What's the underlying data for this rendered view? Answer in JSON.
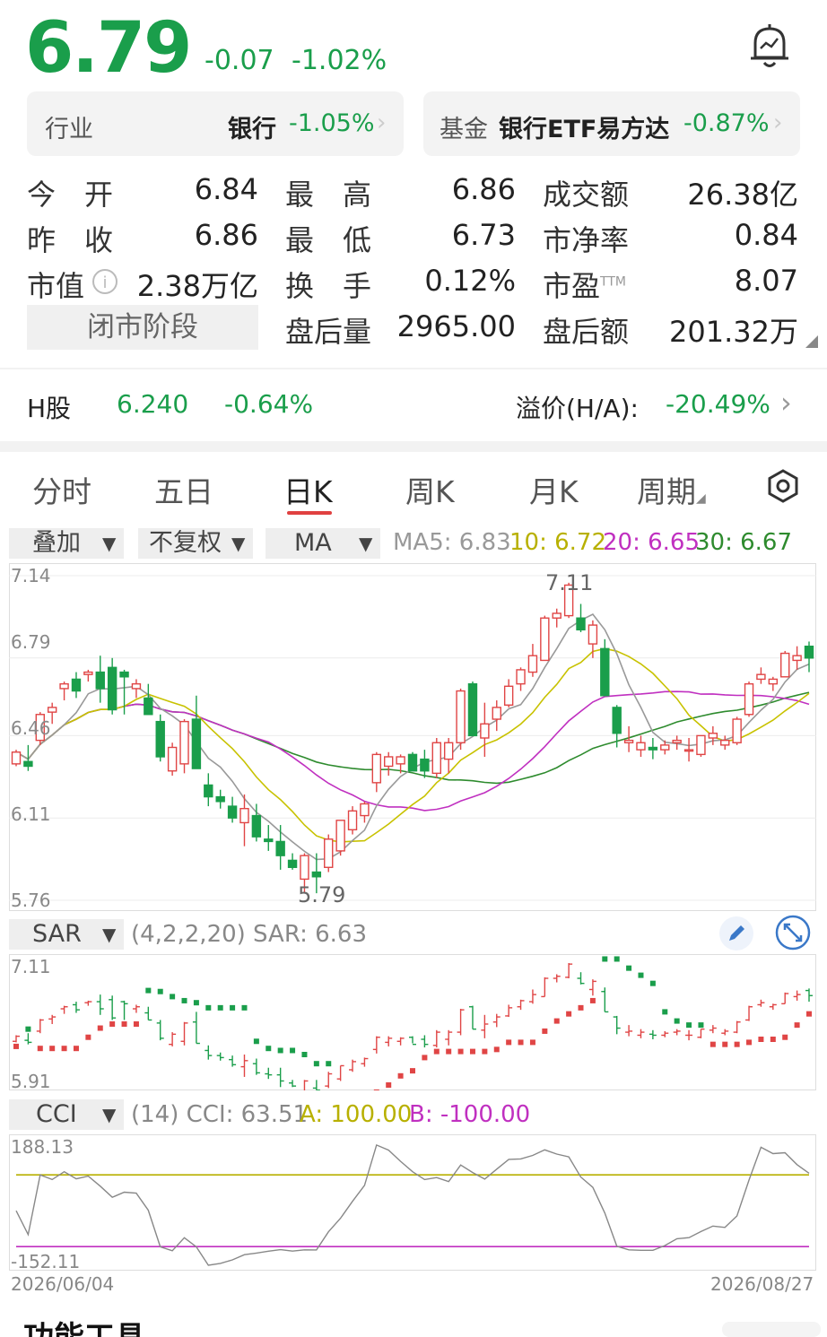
{
  "quote": {
    "price": "6.79",
    "change": "-0.07",
    "change_pct": "-1.02%"
  },
  "industry": {
    "label": "行业",
    "name": "银行",
    "pct": "-1.05%",
    "arrow": "›"
  },
  "fund": {
    "label": "基金",
    "name": "银行ETF易方达",
    "pct": "-0.87%",
    "arrow": "›"
  },
  "stats": {
    "open_label": "今　开",
    "open": "6.84",
    "high_label": "最　高",
    "high": "6.86",
    "turnover_label": "成交额",
    "turnover": "26.38亿",
    "prev_label": "昨　收",
    "prev": "6.86",
    "low_label": "最　低",
    "low": "6.73",
    "pb_label": "市净率",
    "pb": "0.84",
    "mcap_label": "市值",
    "mcap": "2.38万亿",
    "turn_label": "换　手",
    "turn": "0.12%",
    "pe_label": "市盈",
    "pe_sup": "TTM",
    "pe": "8.07",
    "closed_label": "闭市阶段",
    "ah_vol_label": "盘后量",
    "ah_vol": "2965.00",
    "ah_amt_label": "盘后额",
    "ah_amt": "201.32万"
  },
  "hshare": {
    "label": "H股",
    "price": "6.240",
    "pct": "-0.64%",
    "premium_label": "溢价(H/A):",
    "premium": "-20.49%",
    "arrow": "›"
  },
  "tabs": [
    "分时",
    "五日",
    "日K",
    "周K",
    "月K",
    "周期"
  ],
  "active_tab": "日K",
  "toolbar": {
    "overlay": "叠加",
    "adjust": "不复权",
    "indicator": "MA",
    "ma5": "MA5: 6.83",
    "ma10": "10: 6.72",
    "ma20": "20: 6.65",
    "ma30": "30: 6.67"
  },
  "main_chart": {
    "y_top": "7.14",
    "y_2": "6.79",
    "y_3": "6.46",
    "y_4": "6.11",
    "y_bottom": "5.76",
    "high_mark": "7.11",
    "low_mark": "5.79"
  },
  "sar": {
    "name": "SAR",
    "params": "(4,2,2,20) SAR: 6.63",
    "y_top": "7.11",
    "y_bottom": "5.91"
  },
  "cci": {
    "name": "CCI",
    "params": "(14) CCI: 63.51",
    "a": "A: 100.00",
    "b": "B: -100.00",
    "y_top": "188.13",
    "y_bottom": "-152.11",
    "date_start": "2026/06/04",
    "date_end": "2026/08/27"
  },
  "footer_partial": "功能工具",
  "colors": {
    "up": "#e04545",
    "down": "#1a9e4b",
    "ma5": "#999999",
    "ma10": "#c8c200",
    "ma20": "#c030c0",
    "ma30": "#2e8b2e"
  },
  "chart_data": [
    {
      "type": "candlestick",
      "title": "",
      "y_range": [
        5.76,
        7.14
      ],
      "x_range": [
        "2026/06/04",
        "2026/08/27"
      ],
      "annotations": {
        "high": 7.11,
        "low": 5.79
      },
      "ohlc": [
        [
          6.34,
          6.4,
          6.33,
          6.39
        ],
        [
          6.35,
          6.42,
          6.31,
          6.33
        ],
        [
          6.44,
          6.56,
          6.42,
          6.55
        ],
        [
          6.56,
          6.6,
          6.51,
          6.58
        ],
        [
          6.66,
          6.69,
          6.61,
          6.68
        ],
        [
          6.7,
          6.73,
          6.62,
          6.65
        ],
        [
          6.72,
          6.74,
          6.69,
          6.73
        ],
        [
          6.73,
          6.8,
          6.6,
          6.66
        ],
        [
          6.75,
          6.79,
          6.55,
          6.57
        ],
        [
          6.73,
          6.74,
          6.55,
          6.71
        ],
        [
          6.66,
          6.7,
          6.62,
          6.68
        ],
        [
          6.62,
          6.68,
          6.55,
          6.55
        ],
        [
          6.52,
          6.55,
          6.35,
          6.37
        ],
        [
          6.31,
          6.43,
          6.29,
          6.41
        ],
        [
          6.34,
          6.53,
          6.3,
          6.52
        ],
        [
          6.53,
          6.63,
          6.32,
          6.32
        ],
        [
          6.25,
          6.3,
          6.16,
          6.2
        ],
        [
          6.2,
          6.23,
          6.15,
          6.18
        ],
        [
          6.16,
          6.2,
          6.09,
          6.11
        ],
        [
          6.09,
          6.21,
          5.99,
          6.15
        ],
        [
          6.12,
          6.17,
          6.01,
          6.03
        ],
        [
          6.02,
          6.08,
          5.97,
          6.01
        ],
        [
          6.01,
          6.08,
          5.89,
          5.95
        ],
        [
          5.93,
          5.96,
          5.89,
          5.9
        ],
        [
          5.85,
          5.96,
          5.79,
          5.95
        ],
        [
          5.88,
          5.96,
          5.79,
          5.86
        ],
        [
          5.9,
          6.04,
          5.88,
          6.02
        ],
        [
          5.97,
          6.1,
          5.95,
          6.1
        ],
        [
          6.06,
          6.16,
          6.04,
          6.14
        ],
        [
          6.12,
          6.18,
          6.09,
          6.17
        ],
        [
          6.26,
          6.39,
          6.22,
          6.38
        ],
        [
          6.33,
          6.39,
          6.29,
          6.37
        ],
        [
          6.34,
          6.38,
          6.3,
          6.37
        ],
        [
          6.38,
          6.39,
          6.32,
          6.31
        ],
        [
          6.36,
          6.4,
          6.28,
          6.31
        ],
        [
          6.3,
          6.45,
          6.28,
          6.43
        ],
        [
          6.36,
          6.45,
          6.3,
          6.43
        ],
        [
          6.43,
          6.66,
          6.4,
          6.65
        ],
        [
          6.68,
          6.69,
          6.46,
          6.46
        ],
        [
          6.45,
          6.6,
          6.37,
          6.51
        ],
        [
          6.53,
          6.61,
          6.48,
          6.58
        ],
        [
          6.59,
          6.7,
          6.58,
          6.67
        ],
        [
          6.68,
          6.75,
          6.65,
          6.74
        ],
        [
          6.73,
          6.85,
          6.71,
          6.8
        ],
        [
          6.78,
          6.97,
          6.78,
          6.96
        ],
        [
          6.96,
          7.0,
          6.92,
          6.98
        ],
        [
          6.97,
          7.11,
          6.96,
          7.1
        ],
        [
          6.96,
          7.02,
          6.9,
          6.91
        ],
        [
          6.85,
          6.95,
          6.79,
          6.93
        ],
        [
          6.83,
          6.87,
          6.63,
          6.63
        ],
        [
          6.58,
          6.59,
          6.41,
          6.47
        ],
        [
          6.43,
          6.5,
          6.39,
          6.44
        ],
        [
          6.4,
          6.46,
          6.37,
          6.43
        ],
        [
          6.41,
          6.45,
          6.36,
          6.4
        ],
        [
          6.4,
          6.44,
          6.38,
          6.42
        ],
        [
          6.43,
          6.46,
          6.4,
          6.44
        ],
        [
          6.4,
          6.45,
          6.35,
          6.4
        ],
        [
          6.38,
          6.46,
          6.37,
          6.46
        ],
        [
          6.45,
          6.5,
          6.42,
          6.47
        ],
        [
          6.42,
          6.46,
          6.4,
          6.44
        ],
        [
          6.43,
          6.54,
          6.42,
          6.53
        ],
        [
          6.55,
          6.69,
          6.54,
          6.68
        ],
        [
          6.7,
          6.75,
          6.68,
          6.72
        ],
        [
          6.68,
          6.71,
          6.65,
          6.7
        ],
        [
          6.71,
          6.82,
          6.71,
          6.81
        ],
        [
          6.78,
          6.84,
          6.74,
          6.8
        ],
        [
          6.84,
          6.86,
          6.73,
          6.79
        ]
      ]
    },
    {
      "type": "line",
      "title": "",
      "ylabel": "SAR",
      "y_range": [
        5.91,
        7.11
      ]
    },
    {
      "type": "line",
      "title": "",
      "ylabel": "CCI",
      "y_range": [
        -152.11,
        188.13
      ],
      "series": [
        {
          "name": "A",
          "values": [
            100,
            100
          ]
        },
        {
          "name": "B",
          "values": [
            -100,
            -100
          ]
        }
      ]
    }
  ]
}
